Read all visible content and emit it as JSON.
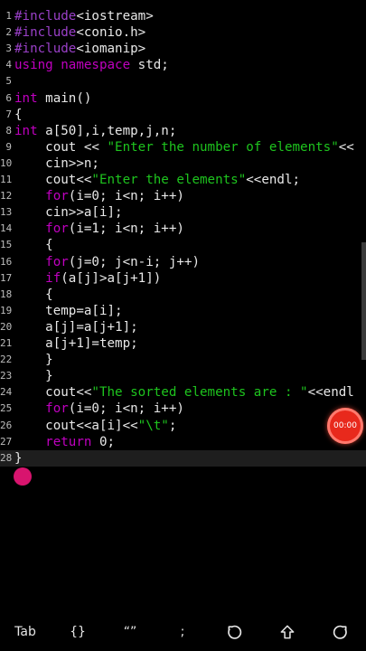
{
  "editor": {
    "lines": [
      [
        {
          "t": "#include",
          "c": "pp"
        },
        {
          "t": "<iostream>"
        }
      ],
      [
        {
          "t": "#include",
          "c": "pp"
        },
        {
          "t": "<conio.h>"
        }
      ],
      [
        {
          "t": "#include",
          "c": "pp"
        },
        {
          "t": "<iomanip>"
        }
      ],
      [
        {
          "t": "using namespace",
          "c": "kw"
        },
        {
          "t": " std;"
        }
      ],
      [],
      [
        {
          "t": "int",
          "c": "kw"
        },
        {
          "t": " main()"
        }
      ],
      [
        {
          "t": "{"
        }
      ],
      [
        {
          "t": "int",
          "c": "kw"
        },
        {
          "t": " a[50],i,temp,j,n;"
        }
      ],
      [
        {
          "t": "    cout << "
        },
        {
          "t": "\"Enter the number of elements\"",
          "c": "str"
        },
        {
          "t": "<<"
        }
      ],
      [
        {
          "t": "    cin>>n;"
        }
      ],
      [
        {
          "t": "    cout<<"
        },
        {
          "t": "\"Enter the elements\"",
          "c": "str"
        },
        {
          "t": "<<endl;"
        }
      ],
      [
        {
          "t": "    "
        },
        {
          "t": "for",
          "c": "kw"
        },
        {
          "t": "(i=0; i<n; i++)"
        }
      ],
      [
        {
          "t": "    cin>>a[i];"
        }
      ],
      [
        {
          "t": "    "
        },
        {
          "t": "for",
          "c": "kw"
        },
        {
          "t": "(i=1; i<n; i++)"
        }
      ],
      [
        {
          "t": "    {"
        }
      ],
      [
        {
          "t": "    "
        },
        {
          "t": "for",
          "c": "kw"
        },
        {
          "t": "(j=0; j<n-i; j++)"
        }
      ],
      [
        {
          "t": "    "
        },
        {
          "t": "if",
          "c": "kw"
        },
        {
          "t": "(a[j]>a[j+1])"
        }
      ],
      [
        {
          "t": "    {"
        }
      ],
      [
        {
          "t": "    temp=a[i];"
        }
      ],
      [
        {
          "t": "    a[j]=a[j+1];"
        }
      ],
      [
        {
          "t": "    a[j+1]=temp;"
        }
      ],
      [
        {
          "t": "    }"
        }
      ],
      [
        {
          "t": "    }"
        }
      ],
      [
        {
          "t": "    cout<<"
        },
        {
          "t": "\"The sorted elements are : \"",
          "c": "str"
        },
        {
          "t": "<<endl"
        }
      ],
      [
        {
          "t": "    "
        },
        {
          "t": "for",
          "c": "kw"
        },
        {
          "t": "(i=0; i<n; i++)"
        }
      ],
      [
        {
          "t": "    cout<<a[i]<<"
        },
        {
          "t": "\"\\t\"",
          "c": "str"
        },
        {
          "t": ";"
        }
      ],
      [
        {
          "t": "    "
        },
        {
          "t": "return",
          "c": "kw"
        },
        {
          "t": " 0;"
        }
      ],
      [
        {
          "t": "}"
        }
      ]
    ],
    "current_line": 28
  },
  "recorder": {
    "time": "00:00",
    "color": "#e8291c"
  },
  "toolbar": {
    "tab": "Tab",
    "braces": "{}",
    "quotes": "“”",
    "semicolon": ";"
  },
  "colors": {
    "keyword": "#c000c0",
    "preprocessor": "#9a40c8",
    "string": "#1ec41e"
  }
}
